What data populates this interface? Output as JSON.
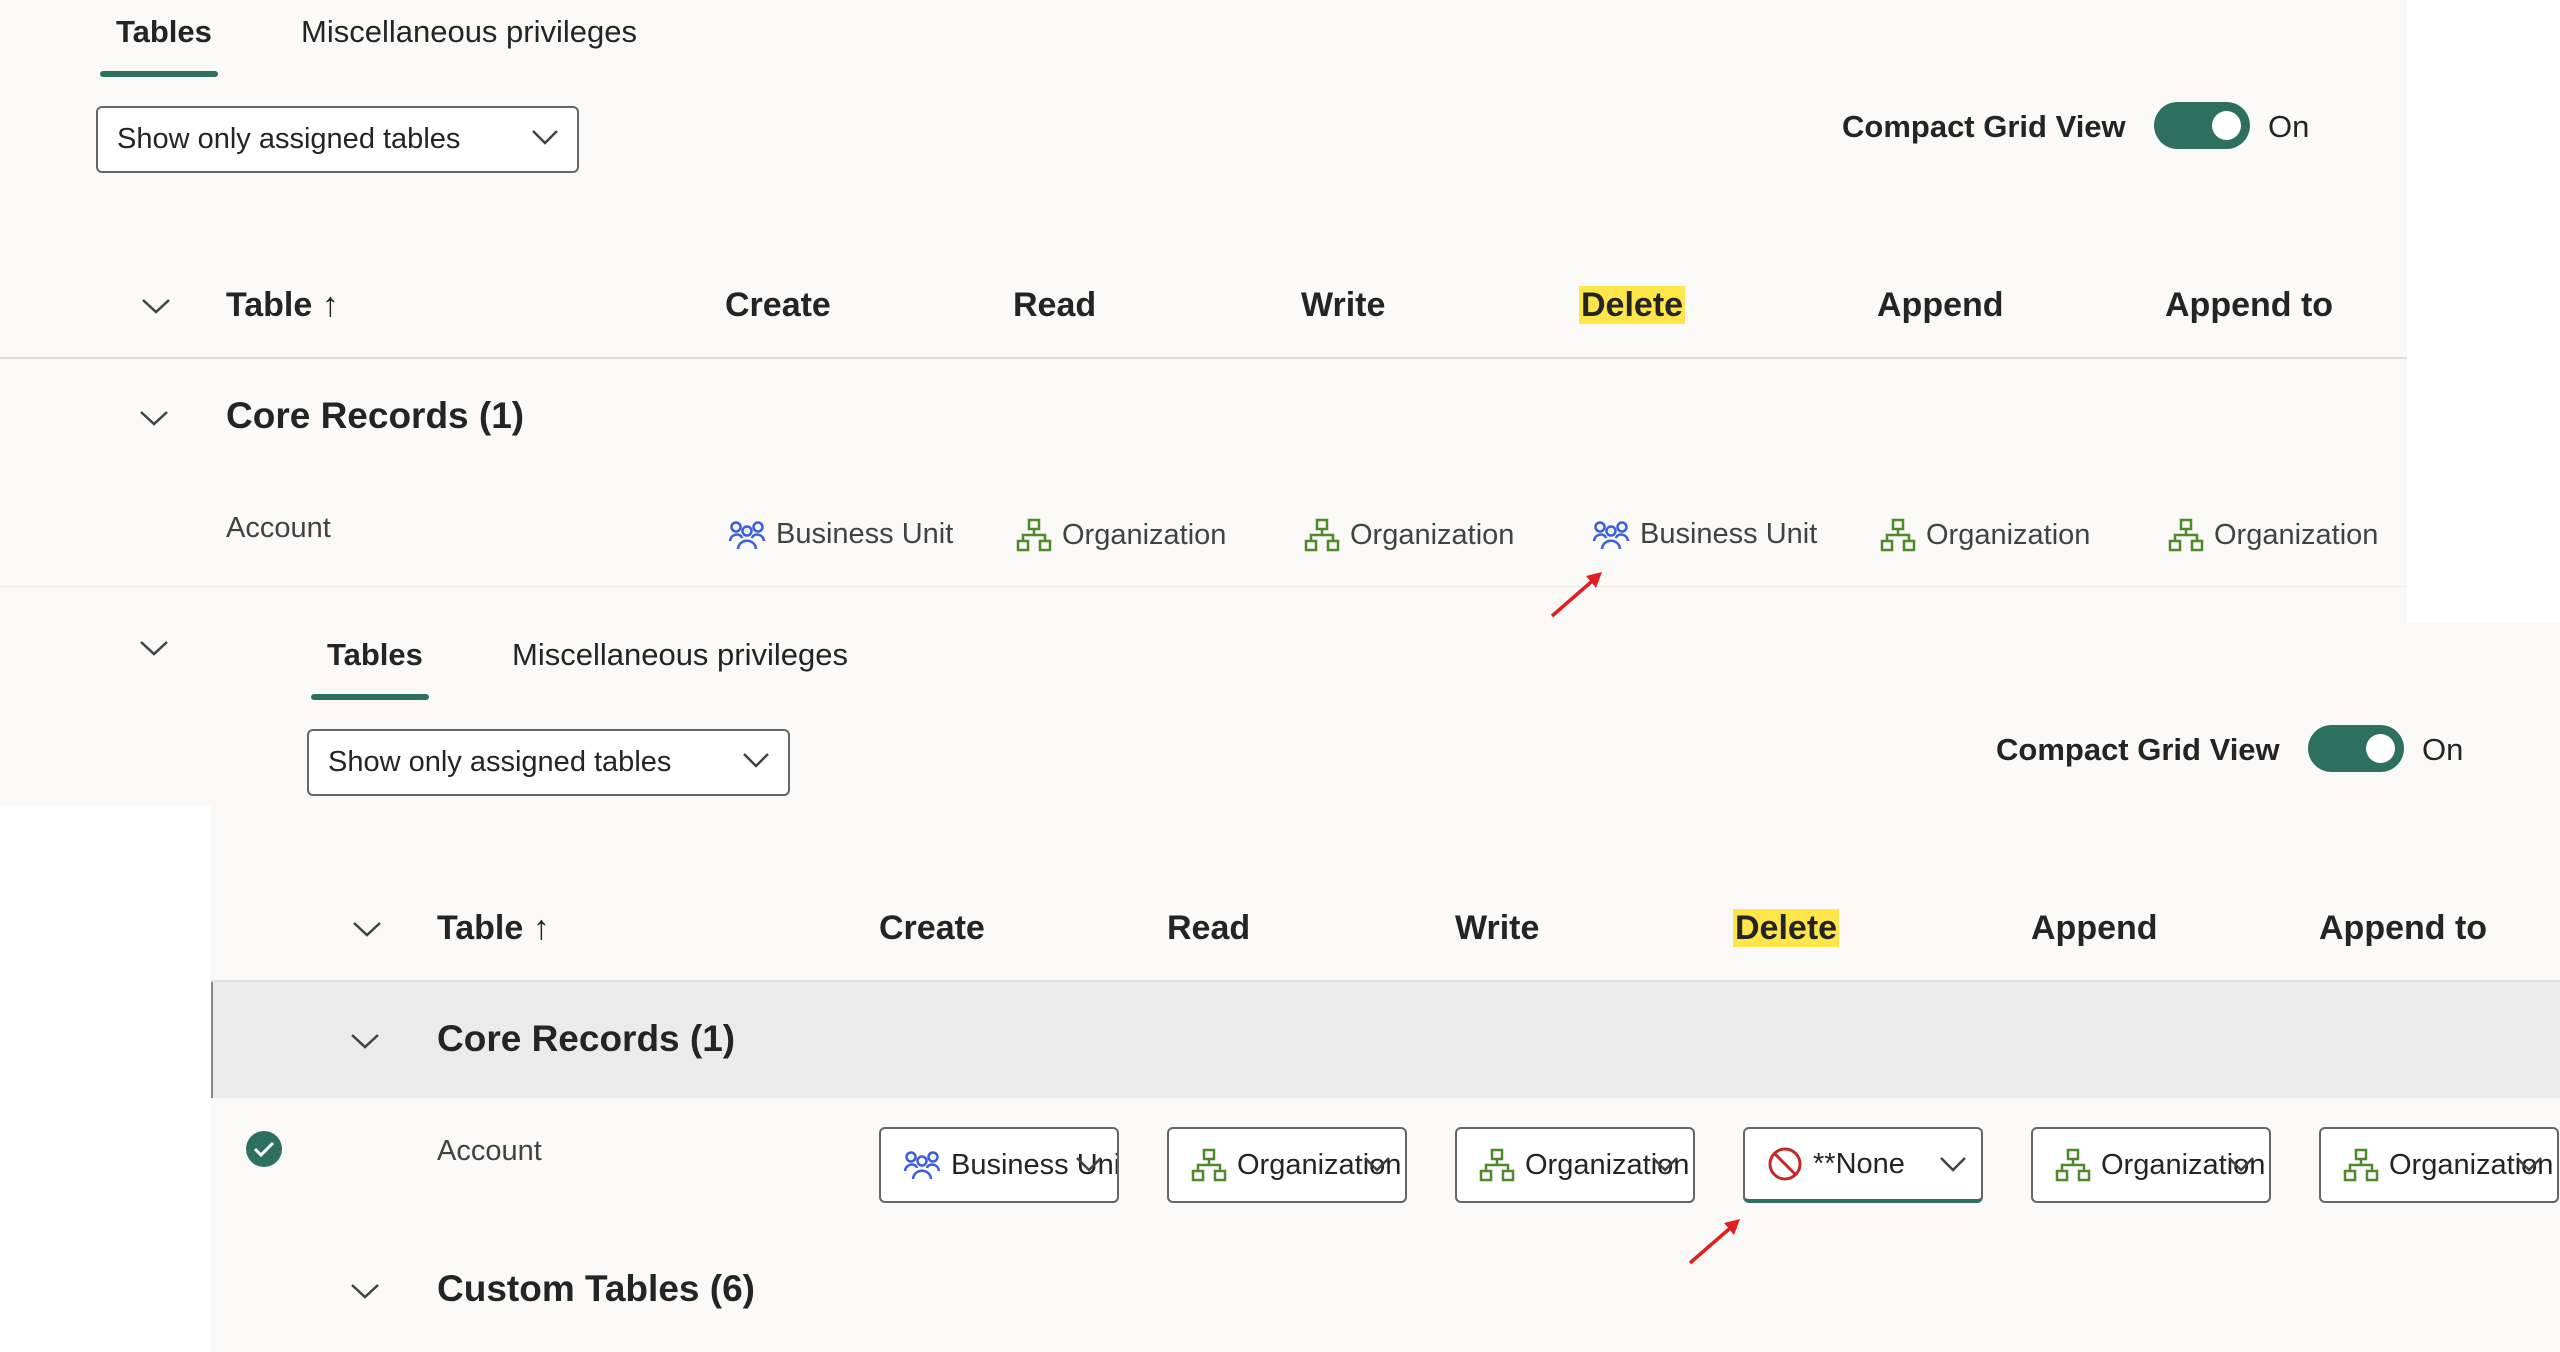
{
  "tabs": [
    {
      "label": "Tables",
      "active": true
    },
    {
      "label": "Miscellaneous privileges",
      "active": false
    }
  ],
  "filter_dropdown": {
    "value": "Show only assigned tables"
  },
  "compact_grid": {
    "label": "Compact Grid View",
    "state_label": "On",
    "enabled": true
  },
  "columns": {
    "table": "Table",
    "sort_indicator": "↑",
    "create": "Create",
    "read": "Read",
    "write": "Write",
    "delete": "Delete",
    "append": "Append",
    "append_to": "Append to"
  },
  "groups": {
    "core_records": {
      "title": "Core Records (1)"
    },
    "custom_tables": {
      "title": "Custom Tables (6)"
    }
  },
  "before": {
    "row": {
      "name": "Account",
      "privileges": [
        {
          "column": "Create",
          "level": "Business Unit",
          "icon": "business-unit-icon"
        },
        {
          "column": "Read",
          "level": "Organization",
          "icon": "organization-icon"
        },
        {
          "column": "Write",
          "level": "Organization",
          "icon": "organization-icon"
        },
        {
          "column": "Delete",
          "level": "Business Unit",
          "icon": "business-unit-icon"
        },
        {
          "column": "Append",
          "level": "Organization",
          "icon": "organization-icon"
        },
        {
          "column": "Append to",
          "level": "Organization",
          "icon": "organization-icon"
        }
      ]
    }
  },
  "after": {
    "row": {
      "name": "Account",
      "selected": true,
      "privileges": [
        {
          "column": "Create",
          "level": "Business Unit",
          "icon": "business-unit-icon"
        },
        {
          "column": "Read",
          "level": "Organization",
          "icon": "organization-icon"
        },
        {
          "column": "Write",
          "level": "Organization",
          "icon": "organization-icon"
        },
        {
          "column": "Delete",
          "level": "**None",
          "icon": "none-icon"
        },
        {
          "column": "Append",
          "level": "Organization",
          "icon": "organization-icon"
        },
        {
          "column": "Append to",
          "level": "Organization",
          "icon": "organization-icon"
        }
      ]
    }
  },
  "colors": {
    "accent": "#2e7060",
    "highlight": "#fde54a",
    "business_unit_icon": "#3a5fd8",
    "organization_icon": "#4e8a2c",
    "none_icon": "#c62828",
    "annotation_arrow": "#e02020"
  }
}
